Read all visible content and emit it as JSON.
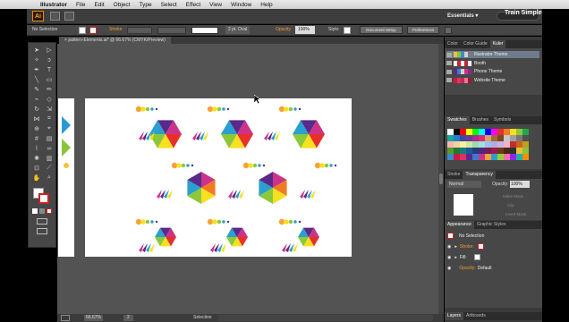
{
  "menubar": {
    "items": [
      "Illustrator",
      "File",
      "Edit",
      "Object",
      "Type",
      "Select",
      "Effect",
      "View",
      "Window",
      "Help"
    ]
  },
  "appbar": {
    "logo": "Ai",
    "workspace": "Essentials ▾",
    "brand": "Train Simple"
  },
  "control": {
    "selection": "No Selection",
    "stroke_label": "Stroke",
    "brush": "2 pt. Oval",
    "opacity_label": "Opacity",
    "opacity_value": "100%",
    "style_label": "Style:",
    "doc_setup": "Document Setup",
    "preferences": "Preferences"
  },
  "document": {
    "tab_title": "pattern-Elements.ai* @ 66.67% (CMYK/Preview)"
  },
  "status": {
    "zoom": "66.67%",
    "page": "2",
    "tool": "Selection"
  },
  "color_panel": {
    "tabs": [
      "Color",
      "Color Guide",
      "Kuler"
    ],
    "themes": [
      {
        "name": "Illustrator Theme",
        "colors": [
          "#e8c23a",
          "#8ac43a",
          "#3a8ad0",
          "#d0d0d0",
          "#7a7a7a"
        ],
        "selected": true
      },
      {
        "name": "Booth",
        "colors": [
          "#ffffff",
          "#cc2233",
          "#ffffff",
          "#cc2233",
          "#ffffff"
        ],
        "selected": false
      },
      {
        "name": "Phone Theme",
        "colors": [
          "#5a2a8a",
          "#3a7ad0",
          "#d0d0d0",
          "#cc3388",
          "#8a2a8a"
        ],
        "selected": false
      },
      {
        "name": "Website Theme",
        "colors": [
          "#cc1a3a",
          "#e0306a",
          "#c02a5a",
          "#e07a9a",
          "#9a1a2a"
        ],
        "selected": false
      }
    ]
  },
  "swatches_panel": {
    "tabs": [
      "Swatches",
      "Brushes",
      "Symbols"
    ],
    "colors": [
      "#ffffff",
      "#000000",
      "#ff0000",
      "#ffff00",
      "#00ff00",
      "#00ffff",
      "#0000ff",
      "#ff00ff",
      "#e8302a",
      "#f07c20",
      "#f8e020",
      "#8cc83c",
      "#20a84a",
      "#1aa7a0",
      "#2080c8",
      "#3a4aa0",
      "#6a3a9a",
      "#b02a8a",
      "#e02a6a",
      "#d8a070",
      "#a06a3a",
      "#7a4a20",
      "#c8c8c8",
      "#a0a0a0",
      "#787878",
      "#505050",
      "#f4b8b0",
      "#f8d0a0",
      "#fcf0a0",
      "#d0e8a0",
      "#a0d8b0",
      "#a0e0e0",
      "#a0c0e8",
      "#b0b0e0",
      "#d0b0e0",
      "#f0b0d0",
      "#c0302a",
      "#d06020",
      "#c0a020",
      "#5a9a2a",
      "#1a7a3a",
      "#1a7a7a",
      "#1a5a9a",
      "#2a3a7a",
      "#4a2a7a",
      "#7a1a5a",
      "#a01a4a",
      "#6a3a20",
      "#4a2a10",
      "#303030",
      "#e8c23a",
      "#8ac43a",
      "#3a8ad0",
      "#cc1a3a",
      "#e0306a",
      "#5a2a8a",
      "#3a7ad0",
      "#cc3388",
      "#f7a23a",
      "#2aa0d0",
      "#9acd32",
      "#ff69b4",
      "#8a2be2",
      "#20b2aa",
      "#ff8c00"
    ]
  },
  "transparency_panel": {
    "tabs": [
      "Stroke",
      "Transparency"
    ],
    "blend": "Normal",
    "opacity_label": "Opacity:",
    "opacity_value": "100%",
    "make_mask": "Make Mask",
    "clip": "Clip",
    "invert_mask": "Invert Mask"
  },
  "appearance_panel": {
    "tabs": [
      "Appearance",
      "Graphic Styles"
    ],
    "title": "No Selection",
    "stroke_label": "Stroke:",
    "fill_label": "Fill:",
    "opacity_label": "Opacity:",
    "opacity_value": "Default"
  },
  "layers_panel": {
    "tabs": [
      "Layers",
      "Artboards"
    ]
  }
}
